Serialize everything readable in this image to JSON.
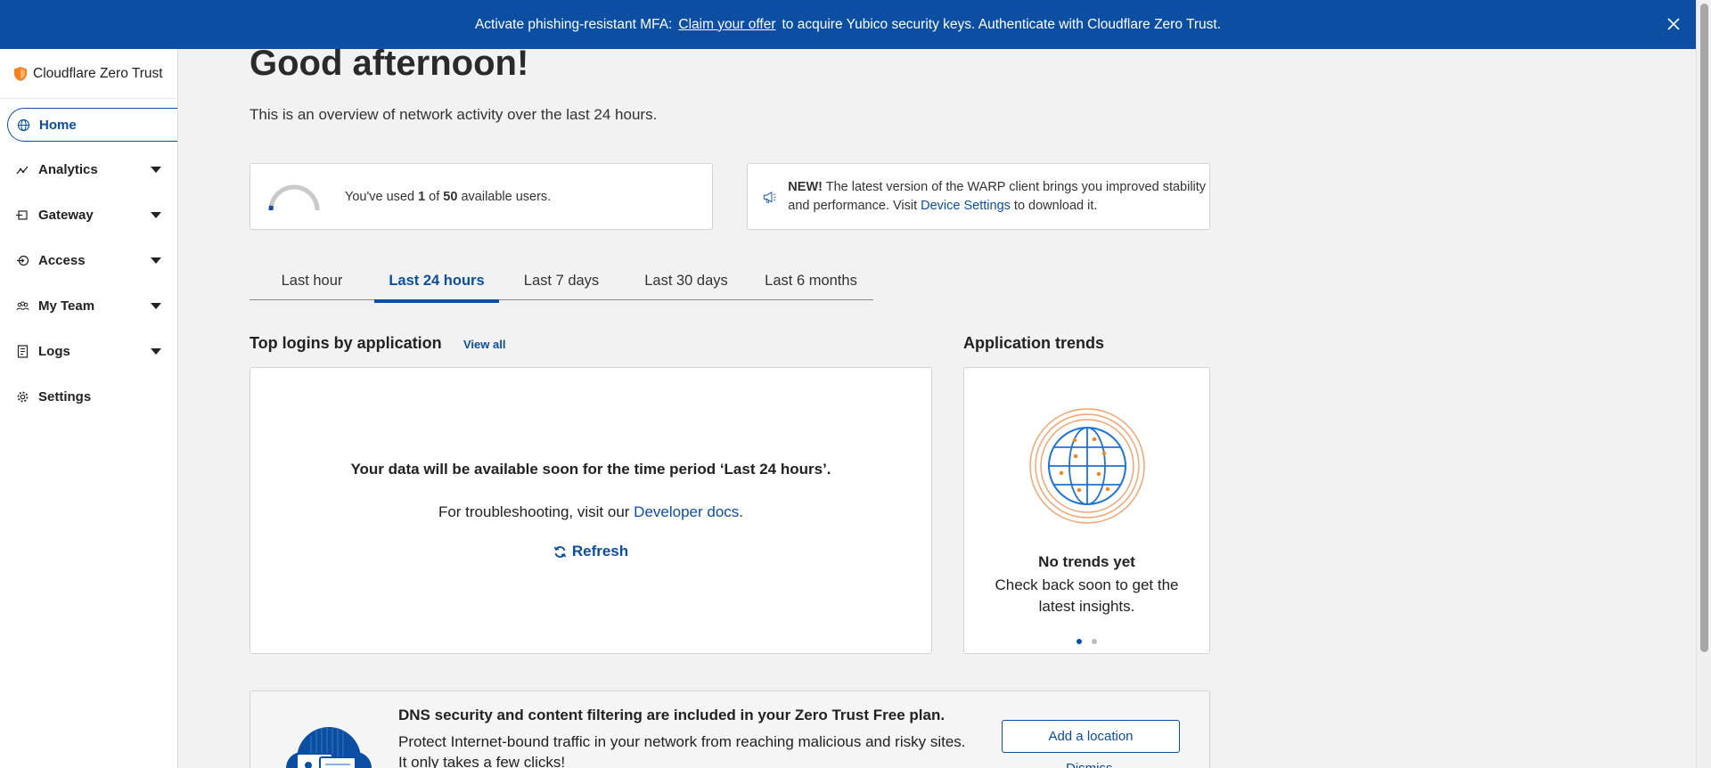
{
  "banner": {
    "text_before": "Activate phishing-resistant MFA:",
    "link": "Claim your offer",
    "text_after": "to acquire Yubico security keys. Authenticate with Cloudflare Zero Trust.",
    "close_icon": "close-icon"
  },
  "sidebar": {
    "brand": "Cloudflare Zero Trust",
    "brand_color": "#f6821f",
    "items": [
      {
        "label": "Home",
        "icon": "globe-icon",
        "active": true
      },
      {
        "label": "Analytics",
        "icon": "analytics-icon",
        "expandable": true
      },
      {
        "label": "Gateway",
        "icon": "gateway-icon",
        "expandable": true
      },
      {
        "label": "Access",
        "icon": "access-icon",
        "expandable": true
      },
      {
        "label": "My Team",
        "icon": "team-icon",
        "expandable": true
      },
      {
        "label": "Logs",
        "icon": "logs-icon",
        "expandable": true
      },
      {
        "label": "Settings",
        "icon": "gear-icon"
      }
    ]
  },
  "main": {
    "greeting": "Good afternoon!",
    "subtitle": "This is an overview of network activity over the last 24 hours.",
    "users": {
      "prefix": "You've used ",
      "used": "1",
      "middle": " of ",
      "total": "50",
      "suffix": " available users."
    },
    "warp": {
      "bold": "NEW!",
      "text1": " The latest version of the WARP client brings you improved stability and performance. Visit ",
      "link": "Device Settings",
      "text2": " to download it."
    },
    "tabs": [
      "Last hour",
      "Last 24 hours",
      "Last 7 days",
      "Last 30 days",
      "Last 6 months"
    ],
    "active_tab": "Last 24 hours",
    "top_logins": {
      "title": "Top logins by application",
      "view_all": "View all",
      "message": "Your data will be available soon for the time period ‘Last 24 hours’.",
      "troubleshoot_prefix": "For troubleshooting, visit our ",
      "troubleshoot_link": "Developer docs",
      "troubleshoot_suffix": ".",
      "refresh": "Refresh"
    },
    "trends": {
      "title": "Application trends",
      "empty_title": "No trends yet",
      "empty_text": "Check back soon to get the latest insights."
    },
    "dns": {
      "title": "DNS security and content filtering are included in your Zero Trust Free plan.",
      "text": "Protect Internet-bound traffic in your network from reaching malicious and risky sites. It only takes a few clicks!",
      "button": "Add a location",
      "dismiss": "Dismiss"
    }
  },
  "colors": {
    "primary": "#0b4ea2",
    "accent": "#f6821f"
  }
}
